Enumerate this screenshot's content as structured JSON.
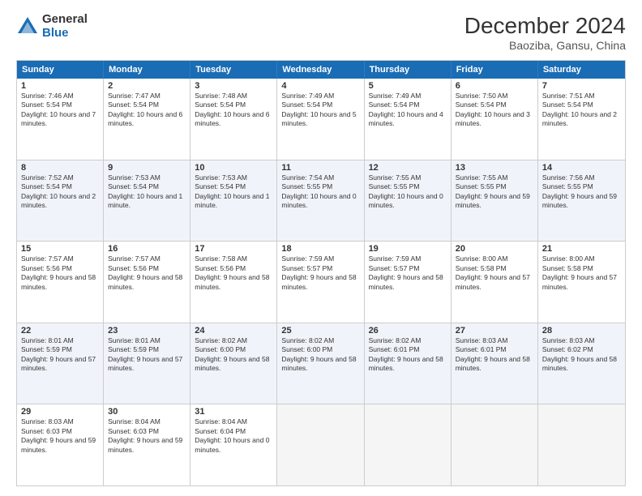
{
  "logo": {
    "general": "General",
    "blue": "Blue"
  },
  "title": "December 2024",
  "subtitle": "Baoziba, Gansu, China",
  "weekdays": [
    "Sunday",
    "Monday",
    "Tuesday",
    "Wednesday",
    "Thursday",
    "Friday",
    "Saturday"
  ],
  "rows": [
    [
      {
        "day": "1",
        "sunrise": "7:46 AM",
        "sunset": "5:54 PM",
        "daylight": "10 hours and 7 minutes."
      },
      {
        "day": "2",
        "sunrise": "7:47 AM",
        "sunset": "5:54 PM",
        "daylight": "10 hours and 6 minutes."
      },
      {
        "day": "3",
        "sunrise": "7:48 AM",
        "sunset": "5:54 PM",
        "daylight": "10 hours and 6 minutes."
      },
      {
        "day": "4",
        "sunrise": "7:49 AM",
        "sunset": "5:54 PM",
        "daylight": "10 hours and 5 minutes."
      },
      {
        "day": "5",
        "sunrise": "7:49 AM",
        "sunset": "5:54 PM",
        "daylight": "10 hours and 4 minutes."
      },
      {
        "day": "6",
        "sunrise": "7:50 AM",
        "sunset": "5:54 PM",
        "daylight": "10 hours and 3 minutes."
      },
      {
        "day": "7",
        "sunrise": "7:51 AM",
        "sunset": "5:54 PM",
        "daylight": "10 hours and 2 minutes."
      }
    ],
    [
      {
        "day": "8",
        "sunrise": "7:52 AM",
        "sunset": "5:54 PM",
        "daylight": "10 hours and 2 minutes."
      },
      {
        "day": "9",
        "sunrise": "7:53 AM",
        "sunset": "5:54 PM",
        "daylight": "10 hours and 1 minute."
      },
      {
        "day": "10",
        "sunrise": "7:53 AM",
        "sunset": "5:54 PM",
        "daylight": "10 hours and 1 minute."
      },
      {
        "day": "11",
        "sunrise": "7:54 AM",
        "sunset": "5:55 PM",
        "daylight": "10 hours and 0 minutes."
      },
      {
        "day": "12",
        "sunrise": "7:55 AM",
        "sunset": "5:55 PM",
        "daylight": "10 hours and 0 minutes."
      },
      {
        "day": "13",
        "sunrise": "7:55 AM",
        "sunset": "5:55 PM",
        "daylight": "9 hours and 59 minutes."
      },
      {
        "day": "14",
        "sunrise": "7:56 AM",
        "sunset": "5:55 PM",
        "daylight": "9 hours and 59 minutes."
      }
    ],
    [
      {
        "day": "15",
        "sunrise": "7:57 AM",
        "sunset": "5:56 PM",
        "daylight": "9 hours and 58 minutes."
      },
      {
        "day": "16",
        "sunrise": "7:57 AM",
        "sunset": "5:56 PM",
        "daylight": "9 hours and 58 minutes."
      },
      {
        "day": "17",
        "sunrise": "7:58 AM",
        "sunset": "5:56 PM",
        "daylight": "9 hours and 58 minutes."
      },
      {
        "day": "18",
        "sunrise": "7:59 AM",
        "sunset": "5:57 PM",
        "daylight": "9 hours and 58 minutes."
      },
      {
        "day": "19",
        "sunrise": "7:59 AM",
        "sunset": "5:57 PM",
        "daylight": "9 hours and 58 minutes."
      },
      {
        "day": "20",
        "sunrise": "8:00 AM",
        "sunset": "5:58 PM",
        "daylight": "9 hours and 57 minutes."
      },
      {
        "day": "21",
        "sunrise": "8:00 AM",
        "sunset": "5:58 PM",
        "daylight": "9 hours and 57 minutes."
      }
    ],
    [
      {
        "day": "22",
        "sunrise": "8:01 AM",
        "sunset": "5:59 PM",
        "daylight": "9 hours and 57 minutes."
      },
      {
        "day": "23",
        "sunrise": "8:01 AM",
        "sunset": "5:59 PM",
        "daylight": "9 hours and 57 minutes."
      },
      {
        "day": "24",
        "sunrise": "8:02 AM",
        "sunset": "6:00 PM",
        "daylight": "9 hours and 58 minutes."
      },
      {
        "day": "25",
        "sunrise": "8:02 AM",
        "sunset": "6:00 PM",
        "daylight": "9 hours and 58 minutes."
      },
      {
        "day": "26",
        "sunrise": "8:02 AM",
        "sunset": "6:01 PM",
        "daylight": "9 hours and 58 minutes."
      },
      {
        "day": "27",
        "sunrise": "8:03 AM",
        "sunset": "6:01 PM",
        "daylight": "9 hours and 58 minutes."
      },
      {
        "day": "28",
        "sunrise": "8:03 AM",
        "sunset": "6:02 PM",
        "daylight": "9 hours and 58 minutes."
      }
    ],
    [
      {
        "day": "29",
        "sunrise": "8:03 AM",
        "sunset": "6:03 PM",
        "daylight": "9 hours and 59 minutes."
      },
      {
        "day": "30",
        "sunrise": "8:04 AM",
        "sunset": "6:03 PM",
        "daylight": "9 hours and 59 minutes."
      },
      {
        "day": "31",
        "sunrise": "8:04 AM",
        "sunset": "6:04 PM",
        "daylight": "10 hours and 0 minutes."
      },
      null,
      null,
      null,
      null
    ]
  ]
}
